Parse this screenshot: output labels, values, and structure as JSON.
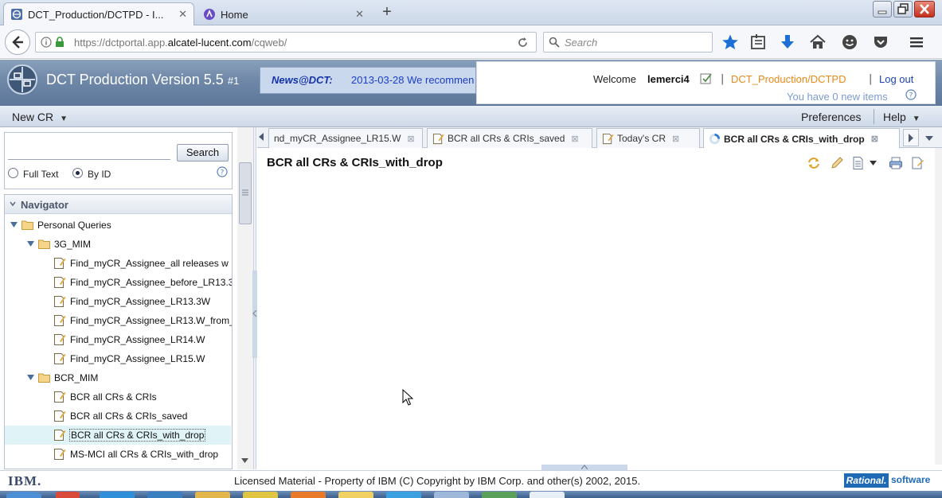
{
  "browser": {
    "tabs": [
      {
        "title": "DCT_Production/DCTPD - I...",
        "active": true
      },
      {
        "title": "Home",
        "active": false
      }
    ],
    "new_tab": "+",
    "url": {
      "prefix": "https://dctportal.app.",
      "domain": "alcatel-lucent.com",
      "path": "/cqweb/"
    },
    "search_placeholder": "Search"
  },
  "app": {
    "title": "DCT Production Version 5.5",
    "title_suffix": "#1",
    "news_label": "News@DCT:",
    "news_text": "2013-03-28 We recommen",
    "welcome_label": "Welcome",
    "username": "lemerci4",
    "separator": "|",
    "db_link": "DCT_Production/DCTPD",
    "logout": "Log out",
    "new_items": "You have 0 new items"
  },
  "menubar": {
    "new_cr": "New CR",
    "preferences": "Preferences",
    "help": "Help"
  },
  "search_panel": {
    "button": "Search",
    "input_value": "",
    "radio_fulltext": "Full Text",
    "radio_byid": "By ID",
    "selected": "By ID"
  },
  "navigator": {
    "title": "Navigator",
    "root": "Personal Queries",
    "folders": [
      {
        "name": "3G_MIM",
        "items": [
          "Find_myCR_Assignee_all releases w",
          "Find_myCR_Assignee_before_LR13.3",
          "Find_myCR_Assignee_LR13.3W",
          "Find_myCR_Assignee_LR13.W_from_",
          "Find_myCR_Assignee_LR14.W",
          "Find_myCR_Assignee_LR15.W"
        ]
      },
      {
        "name": "BCR_MIM",
        "items": [
          "BCR all CRs & CRIs",
          "BCR all CRs & CRIs_saved",
          "BCR all CRs & CRIs_with_drop",
          "MS-MCI all CRs & CRIs_with_drop"
        ]
      }
    ],
    "selected_item": "BCR all CRs & CRIs_with_drop"
  },
  "query_tabs": [
    {
      "label": "nd_myCR_Assignee_LR15.W",
      "active": false
    },
    {
      "label": "BCR all CRs & CRIs_saved",
      "active": false
    },
    {
      "label": "Today's CR",
      "active": false
    },
    {
      "label": "BCR all CRs & CRIs_with_drop",
      "active": true
    }
  ],
  "content": {
    "title": "BCR all CRs & CRIs_with_drop"
  },
  "footer": {
    "ibm": "IBM.",
    "copyright": "Licensed Material - Property of IBM (C) Copyright by IBM Corp. and other(s) 2002, 2015.",
    "rational": "Rational.",
    "software": "software"
  },
  "icons": {
    "tab_close": "close-icon",
    "back": "back-arrow-icon",
    "reload": "reload-icon",
    "bookmark_star": "star-icon",
    "downloads": "download-icon",
    "home": "home-icon",
    "menu": "hamburger-icon"
  },
  "colors": {
    "header_blue": "#6f88a8",
    "db_link": "#e8891a",
    "logout": "#1a44b6",
    "selection": "#e0f4f8",
    "rational_blue": "#1f6ab5"
  }
}
